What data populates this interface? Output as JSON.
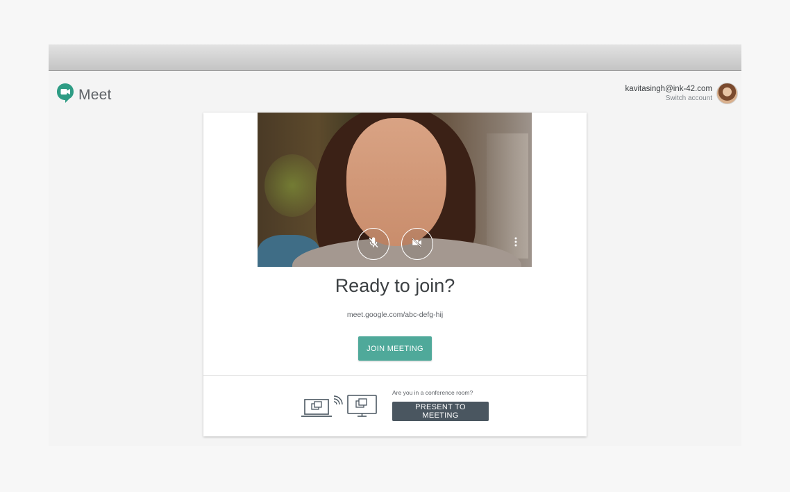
{
  "app": {
    "name": "Meet"
  },
  "account": {
    "email": "kavitasingh@ink-42.com",
    "switch_label": "Switch account"
  },
  "preview": {
    "mic_icon": "mic-off-icon",
    "camera_icon": "videocam-off-icon",
    "more_icon": "more-vert-icon"
  },
  "main": {
    "heading": "Ready to join?",
    "meeting_url": "meet.google.com/abc-defg-hij",
    "join_label": "JOIN MEETING"
  },
  "conference": {
    "question": "Are you in a conference room?",
    "present_label": "PRESENT TO MEETING"
  },
  "colors": {
    "join_button": "#4fa99a",
    "present_button": "#4a5660",
    "logo_green": "#2e9c84"
  }
}
